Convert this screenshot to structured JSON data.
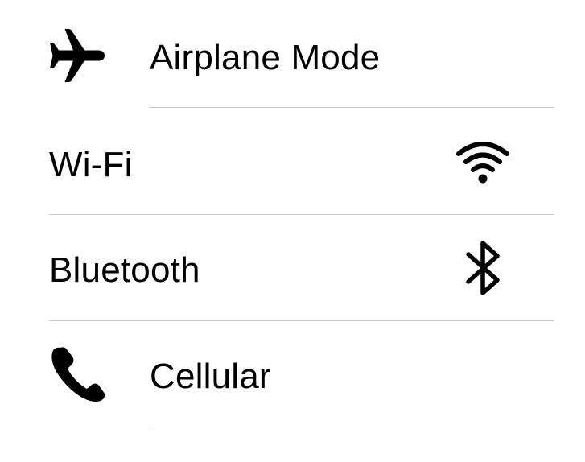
{
  "settings": {
    "items": [
      {
        "label": "Airplane Mode",
        "icon": "airplane-icon"
      },
      {
        "label": "Wi-Fi",
        "icon": "wifi-icon"
      },
      {
        "label": "Bluetooth",
        "icon": "bluetooth-icon"
      },
      {
        "label": "Cellular",
        "icon": "phone-icon"
      }
    ]
  },
  "colors": {
    "text": "#000000",
    "divider": "#c8c8cc",
    "background": "#ffffff"
  }
}
